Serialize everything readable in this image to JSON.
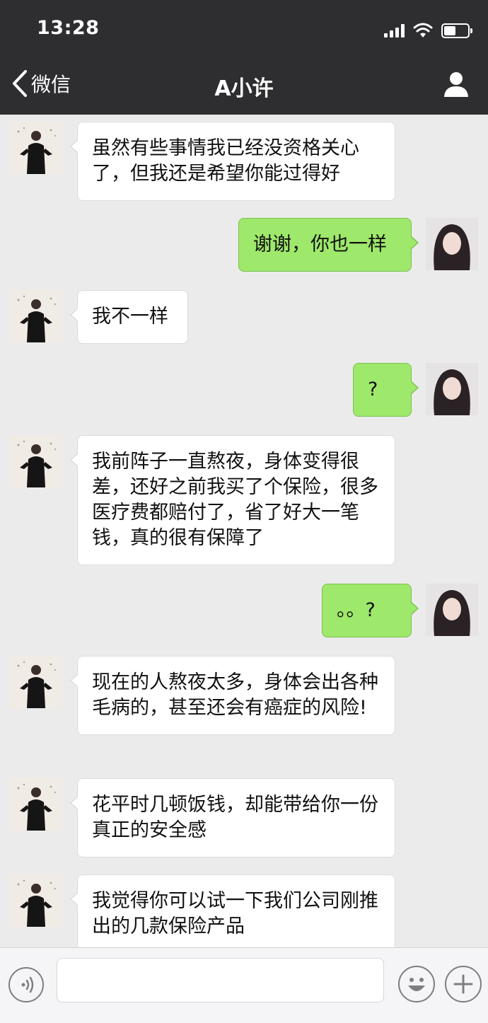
{
  "status_bar": {
    "time": "13:28"
  },
  "nav": {
    "back_label": "微信",
    "title": "A小许"
  },
  "messages": [
    {
      "side": "left",
      "text": "虽然有些事情我已经没资格关心了，但我还是希望你能过得好"
    },
    {
      "side": "right",
      "text": "谢谢，你也一样"
    },
    {
      "side": "left",
      "text": "我不一样"
    },
    {
      "side": "right",
      "text": "?"
    },
    {
      "side": "left",
      "text": "我前阵子一直熬夜，身体变得很差，还好之前我买了个保险，很多医疗费都赔付了，省了好大一笔钱，真的很有保障了"
    },
    {
      "side": "right",
      "text": "。。?"
    },
    {
      "side": "left",
      "text": "现在的人熬夜太多，身体会出各种毛病的，甚至还会有癌症的风险!"
    },
    {
      "side": "left",
      "text": "花平时几顿饭钱，却能带给你一份真正的安全感"
    },
    {
      "side": "left",
      "text": "我觉得你可以试一下我们公司刚推出的几款保险产品"
    }
  ],
  "input": {
    "value": ""
  },
  "colors": {
    "nav_bg": "#2e2e31",
    "chat_bg": "#ebebeb",
    "sent_bubble": "#9ee86b",
    "received_bubble": "#ffffff"
  },
  "icons": [
    "back-chevron-icon",
    "user-profile-icon",
    "voice-icon",
    "emoji-icon",
    "plus-icon",
    "signal-icon",
    "wifi-icon",
    "battery-icon"
  ]
}
